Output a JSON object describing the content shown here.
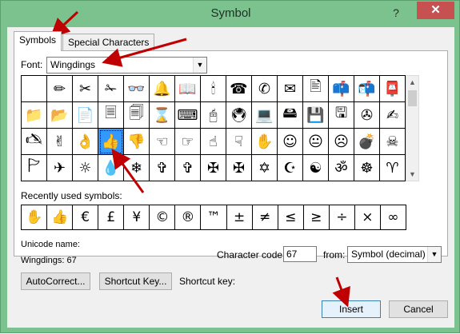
{
  "window": {
    "title": "Symbol",
    "help_glyph": "?",
    "close_glyph": "✕"
  },
  "tabs": [
    {
      "label": "Symbols",
      "active": true
    },
    {
      "label": "Special Characters",
      "active": false
    }
  ],
  "font": {
    "label": "Font:",
    "value": "Wingdings"
  },
  "symbol_grid": {
    "rows": [
      [
        "",
        "✏",
        "✂",
        "✁",
        "👓",
        "🔔",
        "📖",
        "🕯",
        "☎",
        "✆",
        "✉",
        "🖹",
        "📫",
        "📬",
        "📮",
        "🖂"
      ],
      [
        "📁",
        "📂",
        "📄",
        "🗏",
        "🗐",
        "⌛",
        "⌨",
        "🖰",
        "🖲",
        "💻",
        "🖴",
        "💾",
        "🖫",
        "✇",
        "✍"
      ],
      [
        "🖎",
        "✌",
        "👌",
        "👍",
        "👎",
        "☜",
        "☞",
        "☝",
        "☟",
        "✋",
        "☺",
        "😐",
        "☹",
        "💣",
        "☠",
        "⚐"
      ],
      [
        "🏱",
        "✈",
        "☼",
        "💧",
        "❄",
        "✞",
        "✞",
        "✠",
        "✠",
        "✡",
        "☪",
        "☯",
        "ॐ",
        "☸",
        "♈",
        "♉"
      ]
    ],
    "selected_symbol": "👍"
  },
  "recent": {
    "label": "Recently used symbols:",
    "symbols": [
      "✋",
      "👍",
      "€",
      "£",
      "¥",
      "©",
      "®",
      "™",
      "±",
      "≠",
      "≤",
      "≥",
      "÷",
      "×",
      "∞",
      "µ"
    ]
  },
  "unicode": {
    "label": "Unicode name:",
    "value": "Wingdings: 67"
  },
  "character_code": {
    "label": "Character code:",
    "value": "67"
  },
  "from": {
    "label": "from:",
    "value": "Symbol (decimal)"
  },
  "buttons": {
    "autocorrect": "AutoCorrect...",
    "shortcut_key": "Shortcut Key...",
    "insert": "Insert",
    "cancel": "Cancel"
  },
  "shortcut_key_label": "Shortcut key:",
  "colors": {
    "window_frame": "#7cc28f",
    "close_button": "#c75050",
    "selection": "#3399ff",
    "annotation_arrow": "#c00000"
  }
}
